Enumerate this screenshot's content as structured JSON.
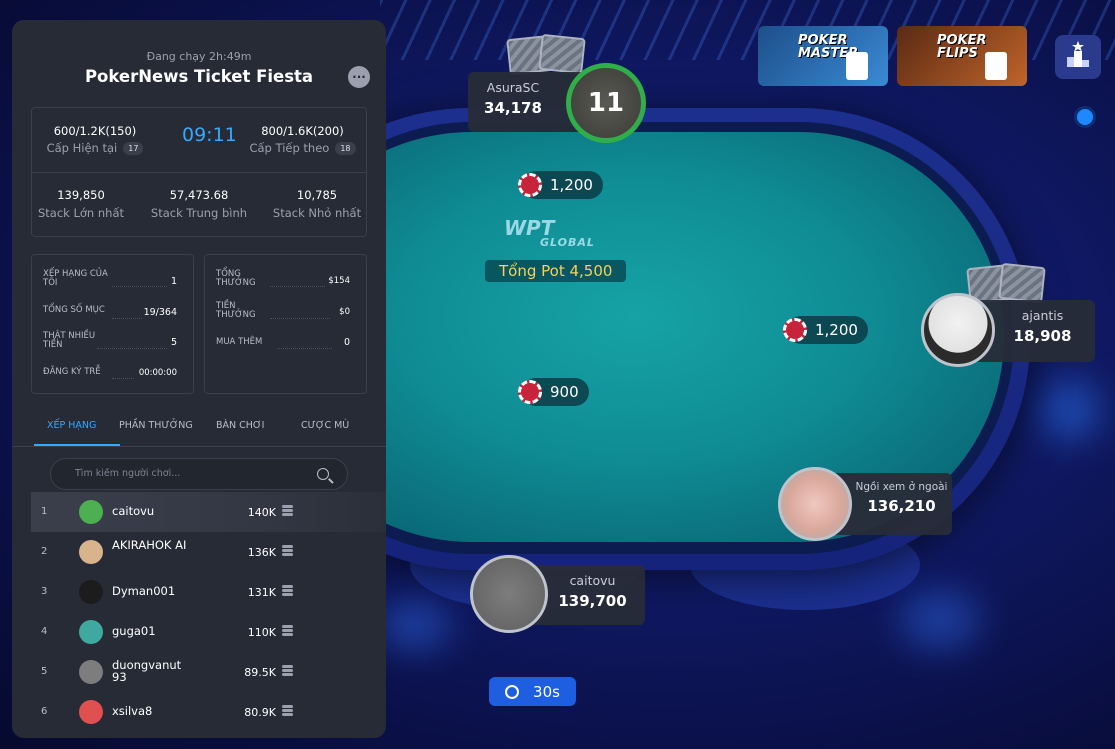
{
  "tournament": {
    "running": "Đang chạy 2h:49m",
    "name": "PokerNews Ticket Fiesta",
    "current_level": {
      "value": "600/1.2K(150)",
      "label": "Cấp Hiện tại",
      "badge": "17"
    },
    "next_level": {
      "value": "800/1.6K(200)",
      "label": "Cấp Tiếp theo",
      "badge": "18"
    },
    "clock": "09:11",
    "stacks": [
      {
        "value": "139,850",
        "label": "Stack Lớn nhất"
      },
      {
        "value": "57,473.68",
        "label": "Stack Trung bình"
      },
      {
        "value": "10,785",
        "label": "Stack Nhỏ nhất"
      }
    ],
    "stats_left": [
      {
        "label": "XẾP HẠNG CỦA TÔI",
        "value": "1"
      },
      {
        "label": "TỔNG SỐ MỤC",
        "value": "19/364"
      },
      {
        "label": "THẬT NHIỀU TIỀN",
        "value": "5"
      },
      {
        "label": "ĐĂNG KÝ TRỄ",
        "value": "00:00:00"
      }
    ],
    "stats_right": [
      {
        "label": "TỔNG THƯỞNG",
        "value": "$154"
      },
      {
        "label": "TIỀN THƯỞNG",
        "value": "$0"
      },
      {
        "label": "MUA THÊM",
        "value": "0"
      }
    ]
  },
  "tabs": [
    "XẾP HẠNG",
    "PHẦN THƯỞNG",
    "BÀN CHƠI",
    "CƯỢC MÙ"
  ],
  "search": {
    "placeholder": "Tìm kiếm người chơi..."
  },
  "ranking": [
    {
      "rank": "1",
      "name": "caitovu",
      "chips": "140K",
      "color": "#4caf50"
    },
    {
      "rank": "2",
      "name": "AKIRAHOK AI",
      "chips": "136K",
      "color": "#d9b38c"
    },
    {
      "rank": "3",
      "name": "Dyman001",
      "chips": "131K",
      "color": "#1c1c1c"
    },
    {
      "rank": "4",
      "name": "guga01",
      "chips": "110K",
      "color": "#3fa9a0"
    },
    {
      "rank": "5",
      "name": "duongvanut 93",
      "chips": "89.5K",
      "color": "#7d7d7d"
    },
    {
      "rank": "6",
      "name": "xsilva8",
      "chips": "80.9K",
      "color": "#e05050"
    }
  ],
  "table": {
    "logo": "WPT",
    "logo_sub": "GLOBAL",
    "pot": "Tổng Pot 4,500",
    "bets": [
      "1,200",
      "1,200",
      "900"
    ],
    "timer": "30s"
  },
  "players": {
    "top": {
      "name": "AsuraSC",
      "stack": "34,178",
      "counter": "11"
    },
    "right": {
      "name": "ajantis",
      "stack": "18,908"
    },
    "bottom_right": {
      "name": "Ngồi xem ở ngoài",
      "stack": "136,210"
    },
    "bottom": {
      "name": "caitovu",
      "stack": "139,700"
    }
  },
  "promos": [
    {
      "text": "POKER MASTER"
    },
    {
      "text": "POKER FLIPS"
    }
  ],
  "colors": {
    "accent": "#33a9ff",
    "pot": "#f4d25b",
    "felt": "#0f8c93"
  }
}
